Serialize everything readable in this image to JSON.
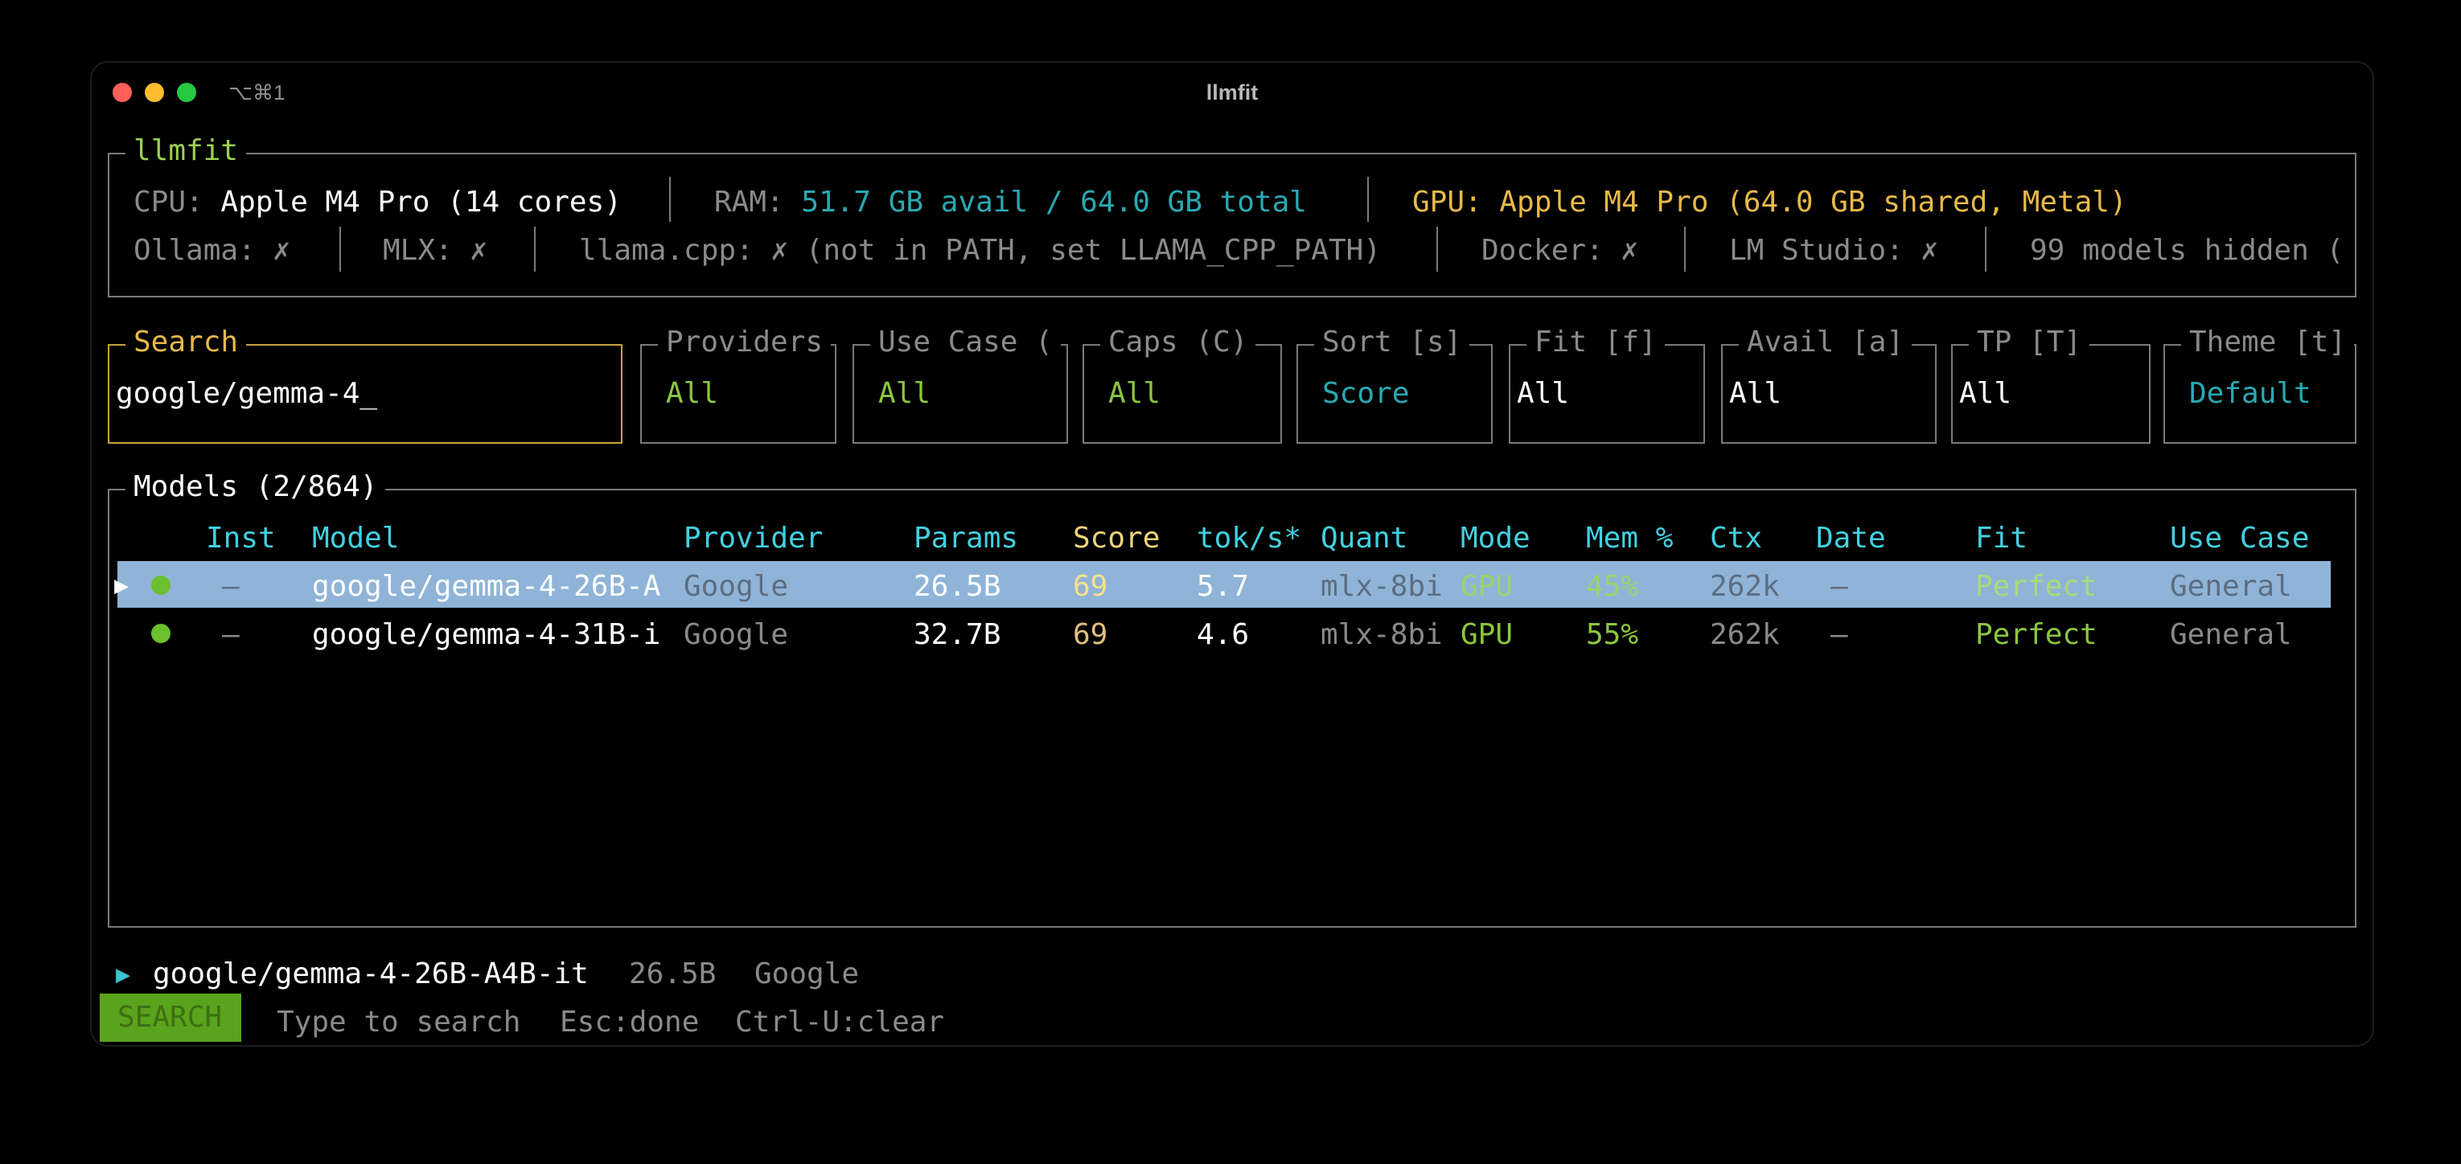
{
  "window": {
    "title": "llmfit",
    "shortcut": "⌥⌘1",
    "traffic_lights": {
      "close": "#ff5f57",
      "minimize": "#febc2e",
      "zoom": "#28c840"
    }
  },
  "system": {
    "panel_title": "llmfit",
    "cpu_label": "CPU:",
    "cpu_value": "Apple M4 Pro (14 cores)",
    "ram_label": "RAM:",
    "ram_value": "51.7 GB avail / 64.0 GB total",
    "gpu_text": "GPU: Apple M4 Pro (64.0 GB shared, Metal)",
    "backends": [
      "Ollama: ✗",
      "MLX: ✗",
      "llama.cpp: ✗ (not in PATH, set LLAMA_CPP_PATH)",
      "Docker: ✗",
      "LM Studio: ✗",
      "99 models hidden ("
    ]
  },
  "search": {
    "label": "Search",
    "value": "google/gemma-4_"
  },
  "filters": [
    {
      "label": "Providers",
      "value": "All"
    },
    {
      "label": "Use Case (",
      "value": "All"
    },
    {
      "label": "Caps (C)",
      "value": "All"
    },
    {
      "label": "Sort [s]",
      "value": "Score"
    },
    {
      "label": "Fit [f]",
      "value": "All"
    },
    {
      "label": "Avail [a]",
      "value": "All"
    },
    {
      "label": "TP [T]",
      "value": "All"
    },
    {
      "label": "Theme [t]",
      "value": "Default"
    }
  ],
  "models": {
    "title": "Models (2/864)",
    "columns": [
      "Inst",
      "Model",
      "Provider",
      "Params",
      "Score",
      "tok/s*",
      "Quant",
      "Mode",
      "Mem %",
      "Ctx",
      "Date",
      "Fit",
      "Use Case"
    ],
    "rows": [
      {
        "selected": true,
        "pointer": "▶",
        "inst": "–",
        "model": "google/gemma-4-26B-A",
        "provider": "Google",
        "params": "26.5B",
        "score": "69",
        "toks": "5.7",
        "quant": "mlx-8bi",
        "mode": "GPU",
        "mem": "45%",
        "ctx": "262k",
        "date": "–",
        "fit": "Perfect",
        "use_case": "General"
      },
      {
        "selected": false,
        "pointer": "",
        "inst": "–",
        "model": "google/gemma-4-31B-i",
        "provider": "Google",
        "params": "32.7B",
        "score": "69",
        "toks": "4.6",
        "quant": "mlx-8bi",
        "mode": "GPU",
        "mem": "55%",
        "ctx": "262k",
        "date": "–",
        "fit": "Perfect",
        "use_case": "General"
      }
    ]
  },
  "detail": {
    "pointer": "▶",
    "model": "google/gemma-4-26B-A4B-it",
    "params": "26.5B",
    "provider": "Google"
  },
  "statusbar": {
    "mode": "SEARCH",
    "hints": [
      "Type to search",
      "Esc:done",
      "Ctrl-U:clear"
    ]
  }
}
